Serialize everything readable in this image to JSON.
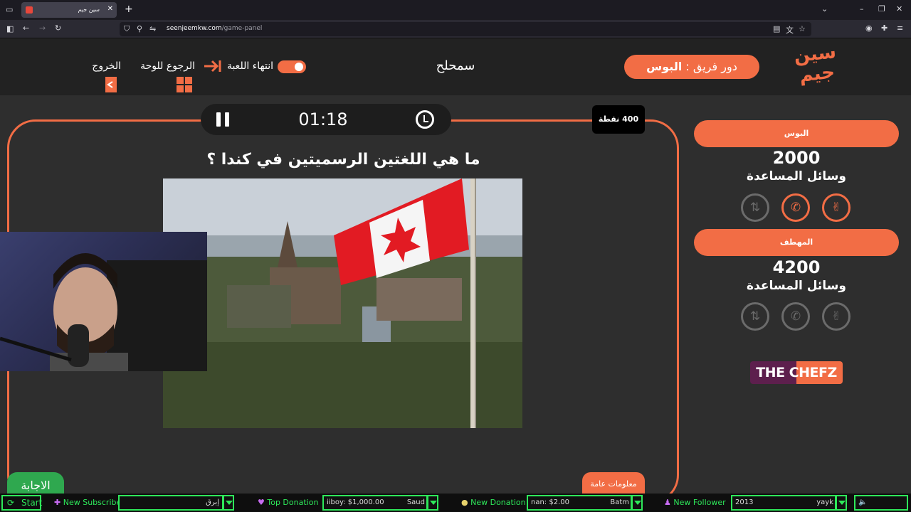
{
  "browser": {
    "tab_title": "سين جيم",
    "url_domain": "seenjeemkw.com",
    "url_path": "/game-panel"
  },
  "header": {
    "logo_text_1": "سين",
    "logo_text_2": "جيم",
    "team_turn_prefix": "دور فريق :",
    "team_turn_name": "البوس",
    "category": "سمحلح",
    "end_game_label": "انتهاء اللعبة",
    "back_to_board_label": "الرجوع للوحة",
    "exit_label": "الخروج"
  },
  "question": {
    "timer": "01:18",
    "points": "400 نقطة",
    "text": "ما هي اللغتين الرسميتين في كندا ؟",
    "info_tab": "معلومات عامة",
    "answer_tab": "الاجابة"
  },
  "teams": [
    {
      "name": "البوس",
      "score": "2000",
      "helpers_label": "وسائل المساعدة"
    },
    {
      "name": "المهطف",
      "score": "4200",
      "helpers_label": "وسائل المساعدة"
    }
  ],
  "sponsor": {
    "text": "THE CHEFZ"
  },
  "stream_bar": {
    "start": "Start",
    "new_subscriber": "New Subscriber",
    "subscriber_value": "إبرق",
    "top_donation": "Top Donation",
    "top_donation_value_left": "iiboy: $1,000.00",
    "top_donation_value_right": "Saud",
    "new_donation": "New Donation",
    "new_donation_value_left": "nan: $2.00",
    "new_donation_value_right": "Batm",
    "new_follower": "New Follower",
    "follower_value_left": "2013",
    "follower_value_right": "yayk"
  },
  "colors": {
    "accent": "#f26d45",
    "background": "#2e2e2e",
    "header": "#222222",
    "stream_green": "#2ee85a"
  }
}
